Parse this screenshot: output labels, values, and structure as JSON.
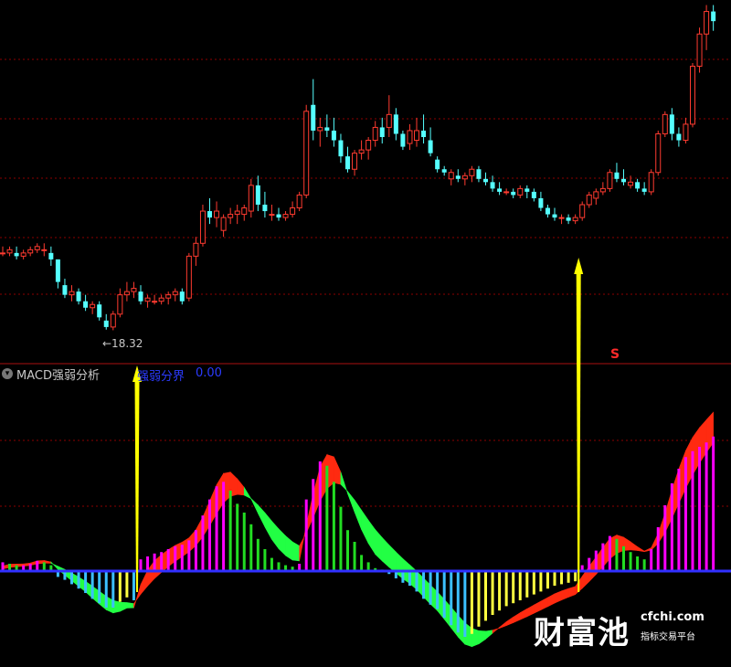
{
  "panel": {
    "title": "MACD强弱分析",
    "indicator_label": "强弱分界",
    "indicator_value": "0.00",
    "low_label": "←18.32",
    "signal_mark": "S"
  },
  "watermark": {
    "brand": "财富池",
    "domain": "cfchi.com",
    "tagline": "指标交易平台"
  },
  "colors": {
    "up": "#ff3b30",
    "down": "#55ffff",
    "grid": "#8b0000",
    "zero_line": "#3030ff",
    "hist_pos_strong": "#ff00ff",
    "hist_pos_weak": "#22dd22",
    "hist_neg_strong": "#ffff40",
    "hist_neg_weak": "#3cc0ff",
    "band_up": "#ff2a10",
    "band_down": "#22ff44",
    "arrow": "#ffff00"
  },
  "chart_data": [
    {
      "type": "candlestick",
      "title": "",
      "annotations": [
        "←18.32",
        "S"
      ],
      "ohlc": [
        [
          20.7,
          20.9,
          20.6,
          20.7
        ],
        [
          20.7,
          20.9,
          20.6,
          20.8
        ],
        [
          20.7,
          20.9,
          20.5,
          20.6
        ],
        [
          20.6,
          20.8,
          20.5,
          20.7
        ],
        [
          20.7,
          20.9,
          20.6,
          20.8
        ],
        [
          20.8,
          21.0,
          20.7,
          20.9
        ],
        [
          20.8,
          21.0,
          20.6,
          20.8
        ],
        [
          20.7,
          20.9,
          20.3,
          20.5
        ],
        [
          20.5,
          20.5,
          19.6,
          19.8
        ],
        [
          19.7,
          19.9,
          19.3,
          19.4
        ],
        [
          19.4,
          19.7,
          19.2,
          19.5
        ],
        [
          19.5,
          19.6,
          19.1,
          19.2
        ],
        [
          19.2,
          19.4,
          18.9,
          19.0
        ],
        [
          19.0,
          19.2,
          18.8,
          19.1
        ],
        [
          19.1,
          19.2,
          18.6,
          18.7
        ],
        [
          18.6,
          18.8,
          18.32,
          18.4
        ],
        [
          18.4,
          18.9,
          18.3,
          18.8
        ],
        [
          18.8,
          19.6,
          18.7,
          19.4
        ],
        [
          19.4,
          19.8,
          19.2,
          19.5
        ],
        [
          19.5,
          19.8,
          19.3,
          19.6
        ],
        [
          19.5,
          19.7,
          19.1,
          19.2
        ],
        [
          19.2,
          19.4,
          19.0,
          19.3
        ],
        [
          19.2,
          19.4,
          19.1,
          19.2
        ],
        [
          19.2,
          19.4,
          19.1,
          19.3
        ],
        [
          19.3,
          19.5,
          19.1,
          19.4
        ],
        [
          19.4,
          19.6,
          19.2,
          19.5
        ],
        [
          19.5,
          19.6,
          19.1,
          19.2
        ],
        [
          19.3,
          20.7,
          19.2,
          20.6
        ],
        [
          20.6,
          21.2,
          20.3,
          21.0
        ],
        [
          21.0,
          22.2,
          20.9,
          22.0
        ],
        [
          22.0,
          22.4,
          21.6,
          21.8
        ],
        [
          21.8,
          22.3,
          21.5,
          22.0
        ],
        [
          21.4,
          21.9,
          21.2,
          21.8
        ],
        [
          21.8,
          22.1,
          21.6,
          21.9
        ],
        [
          21.9,
          22.2,
          21.6,
          22.0
        ],
        [
          21.9,
          22.2,
          21.7,
          22.1
        ],
        [
          22.0,
          23.0,
          21.8,
          22.8
        ],
        [
          22.8,
          23.1,
          22.0,
          22.2
        ],
        [
          22.2,
          22.6,
          21.8,
          22.0
        ],
        [
          21.9,
          22.2,
          21.7,
          21.9
        ],
        [
          21.9,
          22.1,
          21.7,
          21.8
        ],
        [
          21.8,
          22.0,
          21.7,
          21.9
        ],
        [
          21.9,
          22.3,
          21.8,
          22.1
        ],
        [
          22.1,
          22.6,
          22.0,
          22.5
        ],
        [
          22.5,
          25.3,
          22.4,
          25.1
        ],
        [
          25.3,
          26.1,
          24.2,
          24.5
        ],
        [
          24.5,
          24.9,
          24.0,
          24.6
        ],
        [
          24.6,
          25.0,
          24.3,
          24.5
        ],
        [
          24.5,
          24.9,
          24.0,
          24.2
        ],
        [
          24.2,
          24.4,
          23.5,
          23.7
        ],
        [
          23.7,
          24.0,
          23.2,
          23.3
        ],
        [
          23.3,
          23.9,
          23.1,
          23.8
        ],
        [
          23.8,
          24.2,
          23.6,
          23.9
        ],
        [
          23.9,
          24.3,
          23.6,
          24.2
        ],
        [
          24.2,
          24.8,
          24.0,
          24.6
        ],
        [
          24.6,
          24.9,
          24.1,
          24.3
        ],
        [
          24.6,
          25.6,
          24.3,
          25.0
        ],
        [
          25.0,
          25.2,
          24.2,
          24.4
        ],
        [
          24.4,
          24.5,
          23.9,
          24.0
        ],
        [
          24.1,
          24.7,
          23.9,
          24.5
        ],
        [
          24.2,
          24.9,
          24.0,
          24.5
        ],
        [
          24.5,
          25.0,
          24.1,
          24.3
        ],
        [
          24.2,
          24.6,
          23.7,
          23.8
        ],
        [
          23.6,
          23.7,
          23.2,
          23.3
        ],
        [
          23.3,
          23.4,
          23.1,
          23.2
        ],
        [
          23.0,
          23.3,
          22.8,
          23.2
        ],
        [
          23.1,
          23.3,
          22.9,
          23.0
        ],
        [
          23.0,
          23.2,
          22.8,
          23.1
        ],
        [
          23.1,
          23.4,
          22.9,
          23.3
        ],
        [
          23.3,
          23.4,
          22.9,
          23.0
        ],
        [
          23.0,
          23.2,
          22.8,
          22.9
        ],
        [
          22.9,
          23.1,
          22.6,
          22.7
        ],
        [
          22.7,
          22.9,
          22.5,
          22.6
        ],
        [
          22.6,
          22.7,
          22.5,
          22.6
        ],
        [
          22.6,
          22.7,
          22.4,
          22.5
        ],
        [
          22.5,
          22.8,
          22.4,
          22.7
        ],
        [
          22.7,
          22.8,
          22.4,
          22.6
        ],
        [
          22.6,
          22.7,
          22.3,
          22.4
        ],
        [
          22.4,
          22.6,
          22.0,
          22.1
        ],
        [
          22.1,
          22.2,
          21.8,
          21.9
        ],
        [
          21.9,
          22.1,
          21.7,
          21.8
        ],
        [
          21.8,
          21.9,
          21.6,
          21.8
        ],
        [
          21.8,
          21.9,
          21.6,
          21.7
        ],
        [
          21.7,
          21.9,
          21.6,
          21.8
        ],
        [
          21.8,
          22.3,
          21.7,
          22.2
        ],
        [
          22.2,
          22.6,
          22.1,
          22.5
        ],
        [
          22.4,
          22.7,
          22.2,
          22.6
        ],
        [
          22.6,
          22.9,
          22.5,
          22.7
        ],
        [
          22.7,
          23.3,
          22.6,
          23.2
        ],
        [
          23.2,
          23.5,
          22.9,
          23.0
        ],
        [
          23.0,
          23.3,
          22.8,
          22.9
        ],
        [
          22.8,
          23.1,
          22.7,
          22.9
        ],
        [
          22.9,
          23.0,
          22.6,
          22.7
        ],
        [
          22.7,
          22.9,
          22.5,
          22.6
        ],
        [
          22.6,
          23.3,
          22.5,
          23.2
        ],
        [
          23.2,
          24.5,
          23.1,
          24.4
        ],
        [
          24.4,
          25.1,
          24.3,
          25.0
        ],
        [
          25.0,
          25.2,
          24.2,
          24.4
        ],
        [
          24.4,
          24.6,
          24.0,
          24.2
        ],
        [
          24.2,
          24.9,
          24.1,
          24.7
        ],
        [
          24.7,
          26.6,
          24.6,
          26.5
        ],
        [
          26.5,
          27.7,
          26.3,
          27.5
        ],
        [
          27.5,
          28.4,
          27.0,
          28.2
        ],
        [
          28.2,
          28.4,
          27.6,
          27.9
        ]
      ],
      "y_range": [
        18.0,
        28.5
      ]
    },
    {
      "type": "bar",
      "title": "MACD强弱分析",
      "reference_line": {
        "label": "强弱分界",
        "value": 0.0
      },
      "histogram": [
        0.06,
        0.05,
        0.04,
        0.04,
        0.05,
        0.07,
        0.06,
        0.04,
        -0.04,
        -0.06,
        -0.09,
        -0.12,
        -0.15,
        -0.19,
        -0.22,
        -0.25,
        -0.25,
        -0.21,
        -0.18,
        -0.2,
        0.08,
        0.1,
        0.12,
        0.13,
        0.15,
        0.17,
        0.18,
        0.21,
        0.28,
        0.38,
        0.49,
        0.58,
        0.61,
        0.55,
        0.46,
        0.4,
        0.32,
        0.22,
        0.15,
        0.09,
        0.06,
        0.04,
        0.03,
        0.05,
        0.49,
        0.63,
        0.75,
        0.72,
        0.61,
        0.44,
        0.28,
        0.2,
        0.11,
        0.06,
        0.02,
        0.01,
        -0.02,
        -0.05,
        -0.08,
        -0.1,
        -0.14,
        -0.19,
        -0.23,
        -0.26,
        -0.32,
        -0.37,
        -0.42,
        -0.45,
        -0.43,
        -0.38,
        -0.34,
        -0.3,
        -0.27,
        -0.24,
        -0.22,
        -0.2,
        -0.18,
        -0.16,
        -0.14,
        -0.12,
        -0.1,
        -0.09,
        -0.08,
        -0.07,
        0.04,
        0.09,
        0.14,
        0.19,
        0.24,
        0.22,
        0.17,
        0.13,
        0.1,
        0.08,
        0.15,
        0.3,
        0.45,
        0.6,
        0.7,
        0.78,
        0.82,
        0.85,
        0.88,
        0.92
      ],
      "arrows": [
        {
          "from_bar": 20,
          "direction": "up"
        },
        {
          "from_bar": 84,
          "direction": "up"
        }
      ]
    }
  ]
}
